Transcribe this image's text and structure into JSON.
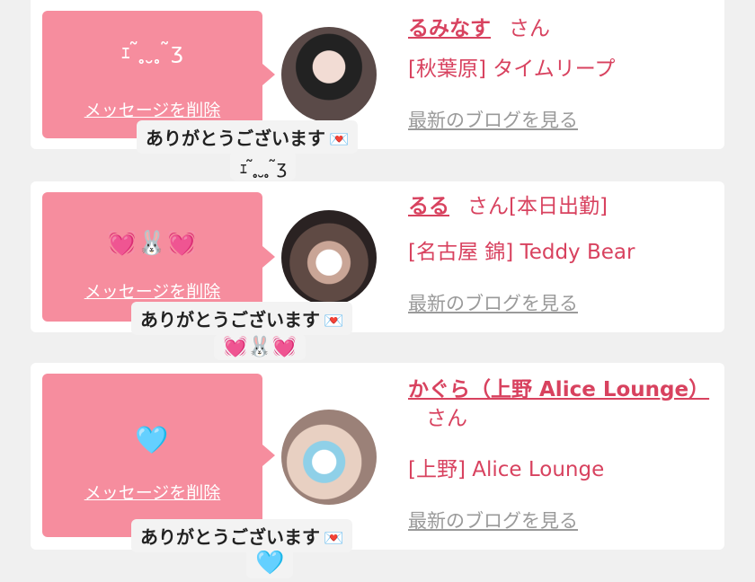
{
  "messages": [
    {
      "bubble_emoji": "ｪ ̃  ̥̥ ̮ ̥̥ ̃ʒ",
      "delete_label": "メッセージを削除",
      "girl_name": "るみなす",
      "honorific": "さん",
      "attendance": "",
      "shop": "[秋葉原] タイムリープ",
      "blog_label": "最新のブログを見る",
      "tooltip_text": "ありがとうございます",
      "tooltip_icon": "💌",
      "tooltip_emoji": "ｪ ̃  ̥̥ ̮ ̥̥ ̃ʒ"
    },
    {
      "bubble_emoji": "💓🐰💓",
      "delete_label": "メッセージを削除",
      "girl_name": "るる",
      "honorific": "さん",
      "attendance": "[本日出勤]",
      "shop": "[名古屋 錦] Teddy Bear",
      "blog_label": "最新のブログを見る",
      "tooltip_text": "ありがとうございます",
      "tooltip_icon": "💌",
      "tooltip_emoji": "💓🐰💓"
    },
    {
      "bubble_emoji": "🩵",
      "delete_label": "メッセージを削除",
      "girl_name": "かぐら（上野 Alice Lounge）",
      "honorific": "さん",
      "attendance": "",
      "shop": "[上野] Alice Lounge",
      "blog_label": "最新のブログを見る",
      "tooltip_text": "ありがとうございます",
      "tooltip_icon": "💌",
      "tooltip_emoji": "🩵"
    }
  ],
  "colors": {
    "bubble": "#f68d9e",
    "accent": "#d8425f",
    "link_gray": "#9a9a9a",
    "background": "#f0f0f0"
  }
}
